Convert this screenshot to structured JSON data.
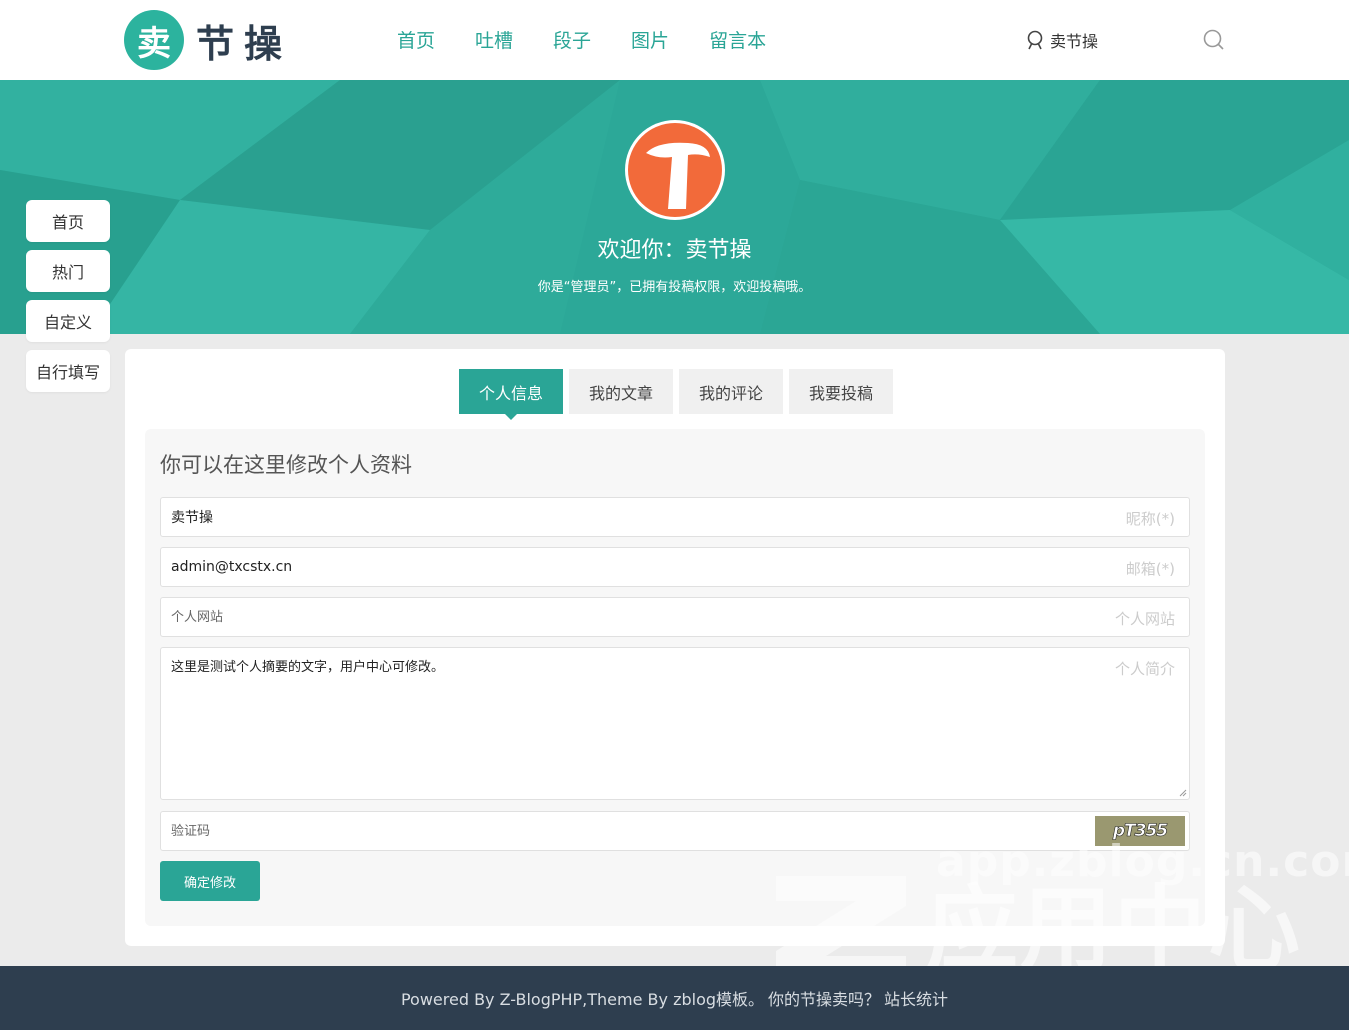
{
  "header": {
    "logo_mark": "卖",
    "logo_text": "节操",
    "nav": [
      "首页",
      "吐槽",
      "段子",
      "图片",
      "留言本"
    ],
    "user_name": "卖节操"
  },
  "banner": {
    "welcome": "欢迎你：卖节操",
    "subtitle": "你是“管理员”，已拥有投稿权限，欢迎投稿哦。"
  },
  "sidenav": [
    "首页",
    "热门",
    "自定义",
    "自行填写"
  ],
  "tabs": [
    "个人信息",
    "我的文章",
    "我的评论",
    "我要投稿"
  ],
  "form": {
    "title": "你可以在这里修改个人资料",
    "nickname": {
      "value": "卖节操",
      "hint": "昵称(*)"
    },
    "email": {
      "value": "admin@txcstx.cn",
      "hint": "邮箱(*)"
    },
    "website": {
      "placeholder": "个人网站",
      "hint": "个人网站"
    },
    "intro": {
      "value": "这里是测试个人摘要的文字，用户中心可修改。",
      "hint": "个人简介"
    },
    "captcha": {
      "placeholder": "验证码",
      "image_text": "pT355"
    },
    "submit": "确定修改"
  },
  "watermark": {
    "url": "app.zblog.cn.com",
    "text": "应用中心"
  },
  "footer": {
    "powered": "Powered By Z-BlogPHP,Theme By zblog模板。",
    "question": "你的节操卖吗？",
    "stats": "站长统计"
  },
  "colors": {
    "accent": "#2aa596",
    "banner": "#2ca898",
    "footer": "#2e3e4f",
    "logo_circle": "#2cb39e",
    "avatar": "#f26a3a"
  }
}
